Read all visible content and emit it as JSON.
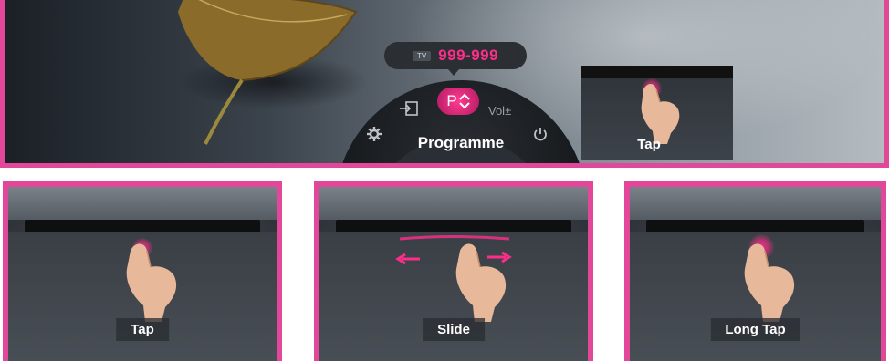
{
  "banner": {
    "channel_tag": "TV",
    "channel_number": "999-999",
    "p_button": "P",
    "vol_label": "Vol±",
    "programme_label": "Programme",
    "tap_label": "Tap",
    "icons": [
      "input-icon",
      "settings-gear-icon",
      "power-icon",
      "up-down-arrows-icon"
    ]
  },
  "panels": [
    {
      "label": "Tap",
      "gesture": "tap"
    },
    {
      "label": "Slide",
      "gesture": "slide"
    },
    {
      "label": "Long Tap",
      "gesture": "long-tap"
    }
  ],
  "colors": {
    "accent": "#e2479a",
    "highlight": "#ff2d8a",
    "dial_bg": "#15181b",
    "text": "#ffffff"
  }
}
